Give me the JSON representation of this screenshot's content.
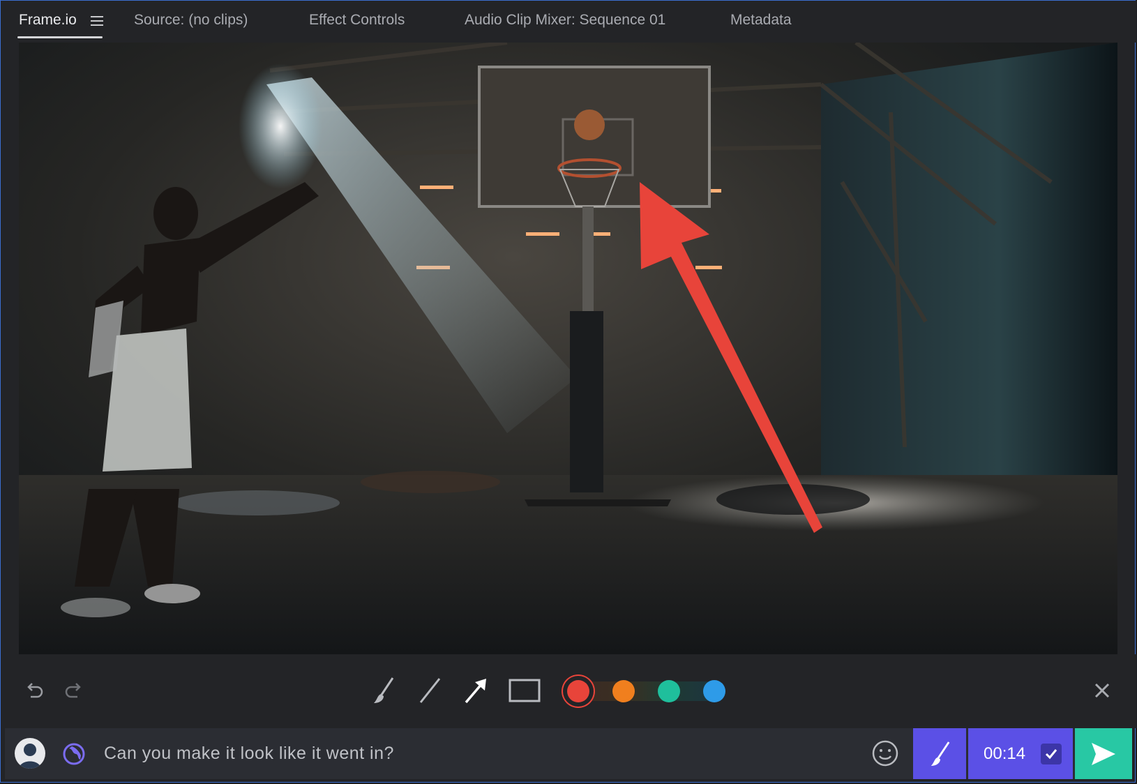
{
  "tabs": [
    {
      "label": "Frame.io",
      "active": true
    },
    {
      "label": "Source: (no clips)"
    },
    {
      "label": "Effect Controls"
    },
    {
      "label": "Audio Clip Mixer: Sequence 01"
    },
    {
      "label": "Metadata"
    }
  ],
  "toolbar": {
    "tools": [
      "undo-icon",
      "redo-icon",
      "brush-icon",
      "line-icon",
      "arrow-icon",
      "rectangle-icon",
      "close-icon"
    ],
    "colors": [
      "#e8443a",
      "#f07f1e",
      "#1fbf9c",
      "#2e9be8"
    ],
    "selected_color": "#e8443a"
  },
  "composer": {
    "comment": "Can you make it look like it went in?",
    "timestamp": "00:14"
  },
  "colors": {
    "accent_purple": "#5b50e6",
    "send_green": "#28c8a4",
    "annotation_red": "#e8443a"
  }
}
